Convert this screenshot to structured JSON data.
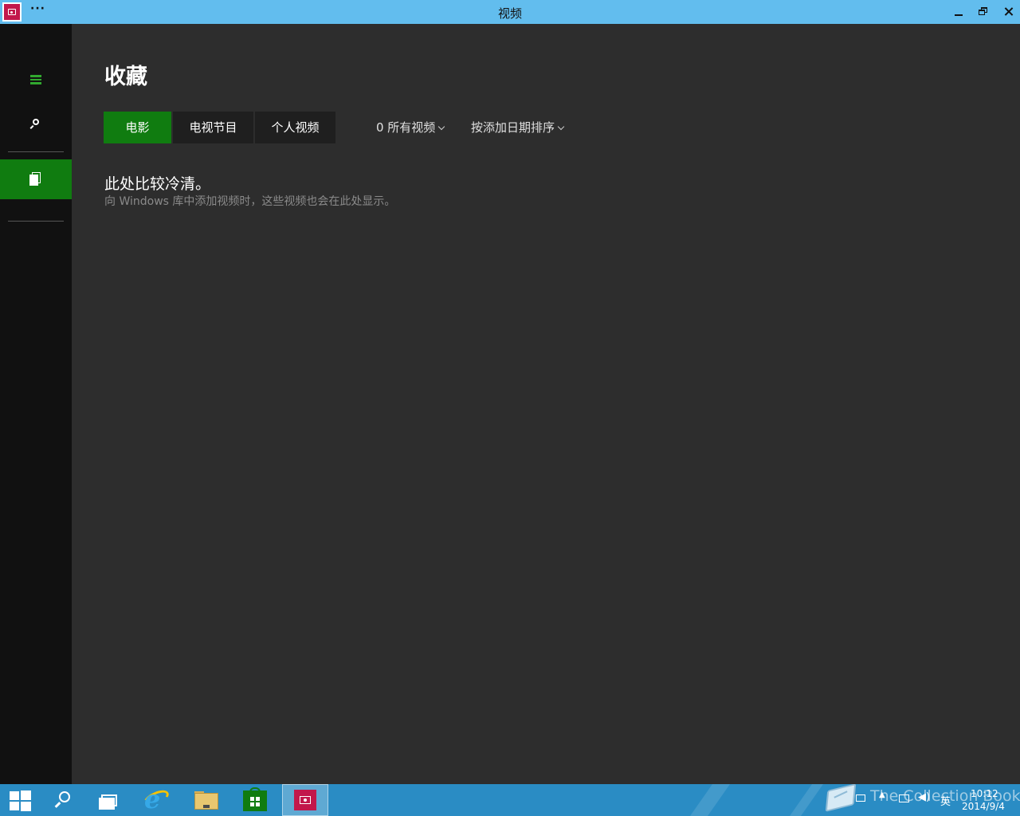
{
  "window": {
    "title": "视频",
    "more_label": "···"
  },
  "sidebar": {
    "hamburger_icon": "hamburger-menu-icon",
    "search_icon": "search-icon",
    "collection_icon": "collection-icon",
    "accent": "#107c10"
  },
  "main": {
    "page_title": "收藏",
    "tabs": [
      {
        "label": "电影",
        "active": true
      },
      {
        "label": "电视节目",
        "active": false
      },
      {
        "label": "个人视频",
        "active": false
      }
    ],
    "filter_dropdown": "0 所有视频",
    "sort_dropdown": "按添加日期排序",
    "empty_title": "此处比较冷清。",
    "empty_desc": "向 Windows 库中添加视频时，这些视频也会在此处显示。"
  },
  "taskbar": {
    "watermark": "The Collection Book",
    "ime_label": "英",
    "clock_time": "10:12",
    "clock_date": "2014/9/4",
    "color": "#2a8cc4"
  }
}
